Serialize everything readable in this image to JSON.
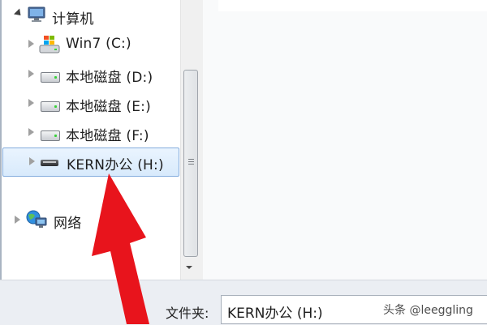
{
  "tree": {
    "computer": {
      "label": "计算机",
      "icon": "computer-icon"
    },
    "drives": [
      {
        "label": "Win7 (C:)",
        "icon": "windows-drive-icon"
      },
      {
        "label": "本地磁盘 (D:)",
        "icon": "hard-drive-icon"
      },
      {
        "label": "本地磁盘 (E:)",
        "icon": "hard-drive-icon"
      },
      {
        "label": "本地磁盘 (F:)",
        "icon": "hard-drive-icon"
      },
      {
        "label": "KERN办公 (H:)",
        "icon": "usb-drive-icon",
        "selected": true
      }
    ],
    "network": {
      "label": "网络",
      "icon": "network-icon"
    }
  },
  "bottom": {
    "folder_label": "文件夹:",
    "folder_value": "KERN办公 (H:)"
  },
  "watermark": "头条 @leeggling",
  "colors": {
    "arrow": "#e8141c",
    "selection_border": "#84acdd"
  }
}
